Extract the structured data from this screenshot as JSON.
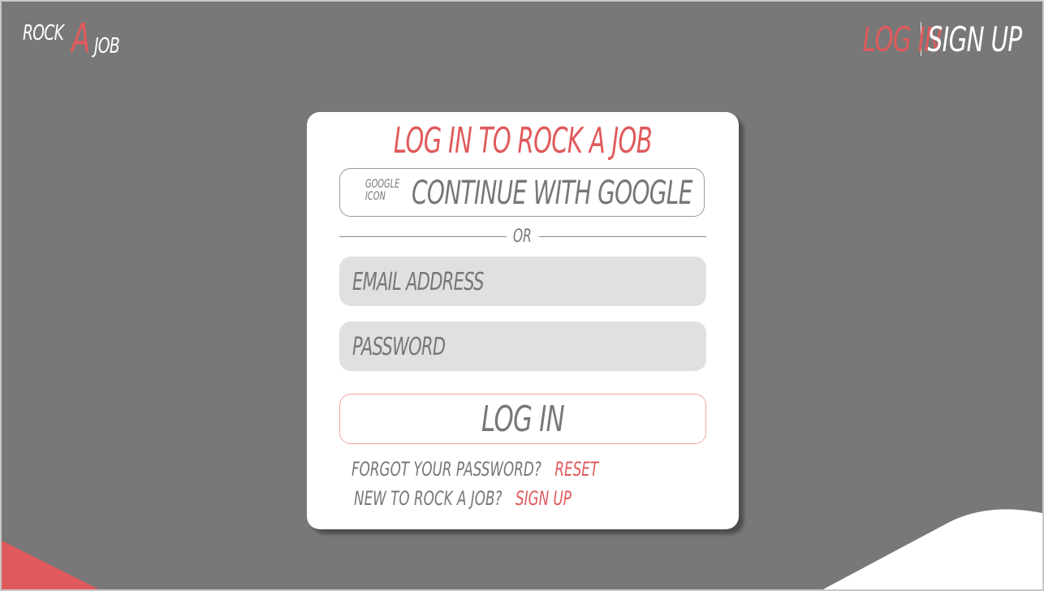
{
  "brand": {
    "logo_part1": "ROCK",
    "logo_part2": "A",
    "logo_part3": "JOB",
    "accent_color": "#e05a5c",
    "background_color": "#787878"
  },
  "nav": {
    "login_label": "LOG IN",
    "signup_label": "SIGN UP"
  },
  "card": {
    "title": "LOG IN TO ROCK A JOB",
    "google": {
      "icon_label": "GOOGLE ICON",
      "icon_line1": "GOOGLE",
      "icon_line2": "ICON",
      "label": "CONTINUE WITH GOOGLE"
    },
    "divider_text": "OR",
    "email": {
      "placeholder": "EMAIL ADDRESS",
      "value": ""
    },
    "password": {
      "placeholder": "PASSWORD",
      "value": ""
    },
    "login_button_label": "LOG IN",
    "forgot": {
      "question": "FORGOT YOUR PASSWORD?",
      "link": "RESET"
    },
    "new_user": {
      "question": "NEW TO ROCK A JOB?",
      "link": "SIGN UP"
    }
  }
}
